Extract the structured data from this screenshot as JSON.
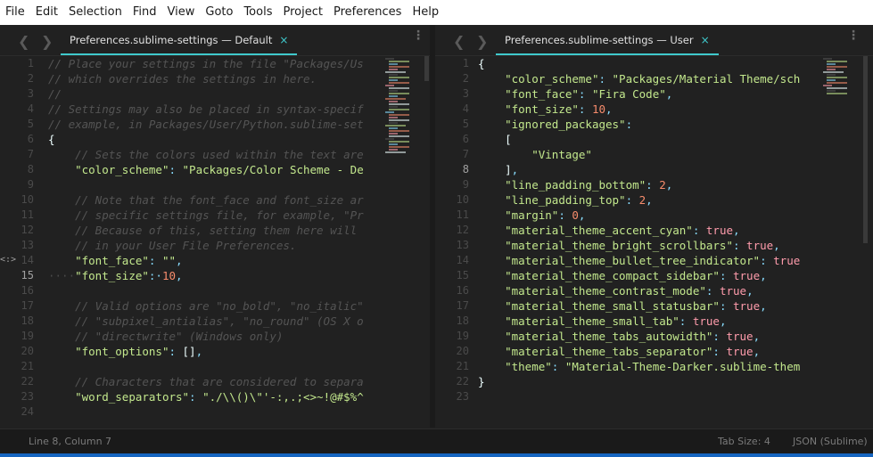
{
  "menu": [
    "File",
    "Edit",
    "Selection",
    "Find",
    "View",
    "Goto",
    "Tools",
    "Project",
    "Preferences",
    "Help"
  ],
  "left": {
    "tab_label": "Preferences.sublime-settings — Default",
    "close_icon": "×",
    "lines": [
      {
        "n": "1",
        "parts": [
          [
            "cm",
            "// Place your settings in the file \"Packages/Us"
          ]
        ]
      },
      {
        "n": "2",
        "parts": [
          [
            "cm",
            "// which overrides the settings in here."
          ]
        ]
      },
      {
        "n": "3",
        "parts": [
          [
            "cm",
            "//"
          ]
        ]
      },
      {
        "n": "4",
        "parts": [
          [
            "cm",
            "// Settings may also be placed in syntax-specif"
          ]
        ]
      },
      {
        "n": "5",
        "parts": [
          [
            "cm",
            "// example, in Packages/User/Python.sublime-set"
          ]
        ]
      },
      {
        "n": "6",
        "parts": [
          [
            "plain",
            "{"
          ]
        ]
      },
      {
        "n": "7",
        "parts": [
          [
            "cm",
            "    // Sets the colors used within the text are"
          ]
        ]
      },
      {
        "n": "8",
        "parts": [
          [
            "plain",
            "    "
          ],
          [
            "key",
            "\"color_scheme\""
          ],
          [
            "pun",
            ": "
          ],
          [
            "str",
            "\"Packages/Color Scheme - De"
          ]
        ]
      },
      {
        "n": "9",
        "parts": [
          [
            "plain",
            ""
          ]
        ]
      },
      {
        "n": "10",
        "parts": [
          [
            "cm",
            "    // Note that the font_face and font_size ar"
          ]
        ]
      },
      {
        "n": "11",
        "parts": [
          [
            "cm",
            "    // specific settings file, for example, \"Pr"
          ]
        ]
      },
      {
        "n": "12",
        "parts": [
          [
            "cm",
            "    // Because of this, setting them here will"
          ]
        ]
      },
      {
        "n": "13",
        "parts": [
          [
            "cm",
            "    // in your User File Preferences."
          ]
        ]
      },
      {
        "n": "14",
        "parts": [
          [
            "plain",
            "    "
          ],
          [
            "key",
            "\"font_face\""
          ],
          [
            "pun",
            ": "
          ],
          [
            "str",
            "\"\""
          ],
          [
            "pun",
            ","
          ]
        ]
      },
      {
        "n": "15",
        "parts": [
          [
            "dots",
            "····"
          ],
          [
            "key",
            "\"font_size\""
          ],
          [
            "pun",
            ":·"
          ],
          [
            "num",
            "10"
          ],
          [
            "pun",
            ","
          ]
        ]
      },
      {
        "n": "16",
        "parts": [
          [
            "plain",
            ""
          ]
        ]
      },
      {
        "n": "17",
        "parts": [
          [
            "cm",
            "    // Valid options are \"no_bold\", \"no_italic\""
          ]
        ]
      },
      {
        "n": "18",
        "parts": [
          [
            "cm",
            "    // \"subpixel_antialias\", \"no_round\" (OS X o"
          ]
        ]
      },
      {
        "n": "19",
        "parts": [
          [
            "cm",
            "    // \"directwrite\" (Windows only)"
          ]
        ]
      },
      {
        "n": "20",
        "parts": [
          [
            "plain",
            "    "
          ],
          [
            "key",
            "\"font_options\""
          ],
          [
            "pun",
            ": "
          ],
          [
            "plain",
            "[]"
          ],
          [
            "pun",
            ","
          ]
        ]
      },
      {
        "n": "21",
        "parts": [
          [
            "plain",
            ""
          ]
        ]
      },
      {
        "n": "22",
        "parts": [
          [
            "cm",
            "    // Characters that are considered to separa"
          ]
        ]
      },
      {
        "n": "23",
        "parts": [
          [
            "plain",
            "    "
          ],
          [
            "key",
            "\"word_separators\""
          ],
          [
            "pun",
            ": "
          ],
          [
            "str",
            "\"./\\\\()\\\"'-:,.;<>~!@#$%^"
          ]
        ]
      },
      {
        "n": "24",
        "parts": [
          [
            "plain",
            ""
          ]
        ]
      }
    ],
    "gutter_marks": {
      "14": "<:>"
    }
  },
  "right": {
    "tab_label": "Preferences.sublime-settings — User",
    "close_icon": "×",
    "lines": [
      {
        "n": "1",
        "parts": [
          [
            "plain",
            "{"
          ]
        ]
      },
      {
        "n": "2",
        "parts": [
          [
            "plain",
            "    "
          ],
          [
            "key",
            "\"color_scheme\""
          ],
          [
            "pun",
            ": "
          ],
          [
            "str",
            "\"Packages/Material Theme/sch"
          ]
        ]
      },
      {
        "n": "3",
        "parts": [
          [
            "plain",
            "    "
          ],
          [
            "key",
            "\"font_face\""
          ],
          [
            "pun",
            ": "
          ],
          [
            "str",
            "\"Fira Code\""
          ],
          [
            "pun",
            ","
          ]
        ]
      },
      {
        "n": "4",
        "parts": [
          [
            "plain",
            "    "
          ],
          [
            "key",
            "\"font_size\""
          ],
          [
            "pun",
            ": "
          ],
          [
            "num",
            "10"
          ],
          [
            "pun",
            ","
          ]
        ]
      },
      {
        "n": "5",
        "parts": [
          [
            "plain",
            "    "
          ],
          [
            "key",
            "\"ignored_packages\""
          ],
          [
            "pun",
            ":"
          ]
        ]
      },
      {
        "n": "6",
        "parts": [
          [
            "plain",
            "    ["
          ]
        ]
      },
      {
        "n": "7",
        "parts": [
          [
            "plain",
            "        "
          ],
          [
            "str",
            "\"Vintage\""
          ]
        ]
      },
      {
        "n": "8",
        "parts": [
          [
            "plain",
            "    ]"
          ],
          [
            "pun",
            ","
          ]
        ]
      },
      {
        "n": "9",
        "parts": [
          [
            "plain",
            "    "
          ],
          [
            "key",
            "\"line_padding_bottom\""
          ],
          [
            "pun",
            ": "
          ],
          [
            "num",
            "2"
          ],
          [
            "pun",
            ","
          ]
        ]
      },
      {
        "n": "10",
        "parts": [
          [
            "plain",
            "    "
          ],
          [
            "key",
            "\"line_padding_top\""
          ],
          [
            "pun",
            ": "
          ],
          [
            "num",
            "2"
          ],
          [
            "pun",
            ","
          ]
        ]
      },
      {
        "n": "11",
        "parts": [
          [
            "plain",
            "    "
          ],
          [
            "key",
            "\"margin\""
          ],
          [
            "pun",
            ": "
          ],
          [
            "num",
            "0"
          ],
          [
            "pun",
            ","
          ]
        ]
      },
      {
        "n": "12",
        "parts": [
          [
            "plain",
            "    "
          ],
          [
            "key",
            "\"material_theme_accent_cyan\""
          ],
          [
            "pun",
            ": "
          ],
          [
            "kw",
            "true"
          ],
          [
            "pun",
            ","
          ]
        ]
      },
      {
        "n": "13",
        "parts": [
          [
            "plain",
            "    "
          ],
          [
            "key",
            "\"material_theme_bright_scrollbars\""
          ],
          [
            "pun",
            ": "
          ],
          [
            "kw",
            "true"
          ],
          [
            "pun",
            ","
          ]
        ]
      },
      {
        "n": "14",
        "parts": [
          [
            "plain",
            "    "
          ],
          [
            "key",
            "\"material_theme_bullet_tree_indicator\""
          ],
          [
            "pun",
            ": "
          ],
          [
            "kw",
            "true"
          ]
        ]
      },
      {
        "n": "15",
        "parts": [
          [
            "plain",
            "    "
          ],
          [
            "key",
            "\"material_theme_compact_sidebar\""
          ],
          [
            "pun",
            ": "
          ],
          [
            "kw",
            "true"
          ],
          [
            "pun",
            ","
          ]
        ]
      },
      {
        "n": "16",
        "parts": [
          [
            "plain",
            "    "
          ],
          [
            "key",
            "\"material_theme_contrast_mode\""
          ],
          [
            "pun",
            ": "
          ],
          [
            "kw",
            "true"
          ],
          [
            "pun",
            ","
          ]
        ]
      },
      {
        "n": "17",
        "parts": [
          [
            "plain",
            "    "
          ],
          [
            "key",
            "\"material_theme_small_statusbar\""
          ],
          [
            "pun",
            ": "
          ],
          [
            "kw",
            "true"
          ],
          [
            "pun",
            ","
          ]
        ]
      },
      {
        "n": "18",
        "parts": [
          [
            "plain",
            "    "
          ],
          [
            "key",
            "\"material_theme_small_tab\""
          ],
          [
            "pun",
            ": "
          ],
          [
            "kw",
            "true"
          ],
          [
            "pun",
            ","
          ]
        ]
      },
      {
        "n": "19",
        "parts": [
          [
            "plain",
            "    "
          ],
          [
            "key",
            "\"material_theme_tabs_autowidth\""
          ],
          [
            "pun",
            ": "
          ],
          [
            "kw",
            "true"
          ],
          [
            "pun",
            ","
          ]
        ]
      },
      {
        "n": "20",
        "parts": [
          [
            "plain",
            "    "
          ],
          [
            "key",
            "\"material_theme_tabs_separator\""
          ],
          [
            "pun",
            ": "
          ],
          [
            "kw",
            "true"
          ],
          [
            "pun",
            ","
          ]
        ]
      },
      {
        "n": "21",
        "parts": [
          [
            "plain",
            "    "
          ],
          [
            "key",
            "\"theme\""
          ],
          [
            "pun",
            ": "
          ],
          [
            "str",
            "\"Material-Theme-Darker.sublime-them"
          ]
        ]
      },
      {
        "n": "22",
        "parts": [
          [
            "plain",
            "}"
          ]
        ]
      },
      {
        "n": "23",
        "parts": [
          [
            "plain",
            ""
          ]
        ]
      }
    ]
  },
  "status": {
    "position": "Line 8, Column 7",
    "tab_size": "Tab Size: 4",
    "syntax": "JSON (Sublime)"
  },
  "colors": {
    "accent": "#3fc9cc",
    "background": "#212121",
    "string": "#c3e88d",
    "number": "#f78c6c",
    "boolean": "#ff9cac"
  },
  "icons": {
    "nav_back": "chevron-left-icon",
    "nav_forward": "chevron-right-icon",
    "menu": "kebab-icon",
    "close": "close-icon"
  }
}
